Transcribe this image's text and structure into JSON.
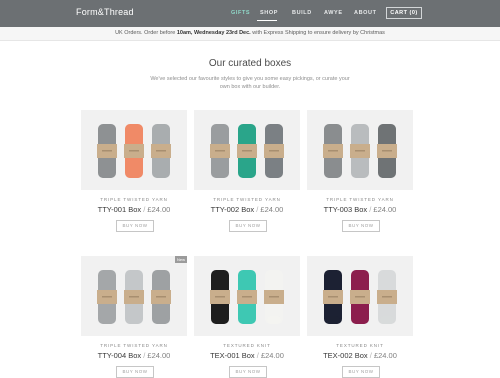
{
  "header": {
    "logo": "Form&Thread",
    "nav": [
      {
        "label": "Gifts",
        "active": true
      },
      {
        "label": "Shop",
        "active": false
      },
      {
        "label": "Build",
        "active": false
      },
      {
        "label": "AWYE",
        "active": false
      },
      {
        "label": "About",
        "active": false
      }
    ],
    "cart_label": "Cart (0)"
  },
  "announcement": {
    "pre": "UK Orders. Order before ",
    "bold": "10am, Wednesday 23rd Dec.",
    "post": " with Express Shipping to ensure delivery by Christmas"
  },
  "section": {
    "title": "Our curated boxes",
    "subtitle": "We've selected our favourite styles to give you some easy pickings, or curate your own box with our builder."
  },
  "products": [
    {
      "category": "Triple Twisted Yarn",
      "code": "TTY-001 Box",
      "price": "£24.00",
      "buy": "Buy Now",
      "badge": "",
      "sock_colors": [
        "#8e9193",
        "#f08a67",
        "#a9adaf"
      ]
    },
    {
      "category": "Triple Twisted Yarn",
      "code": "TTY-002 Box",
      "price": "£24.00",
      "buy": "Buy Now",
      "badge": "",
      "sock_colors": [
        "#9a9d9f",
        "#2aa58a",
        "#7b8084"
      ]
    },
    {
      "category": "Triple Twisted Yarn",
      "code": "TTY-003 Box",
      "price": "£24.00",
      "buy": "Buy Now",
      "badge": "",
      "sock_colors": [
        "#8a8d8f",
        "#b9bcbe",
        "#6f7375"
      ]
    },
    {
      "category": "Triple Twisted Yarn",
      "code": "TTY-004 Box",
      "price": "£24.00",
      "buy": "Buy Now",
      "badge": "New",
      "sock_colors": [
        "#a4a7a9",
        "#c4c7c9",
        "#9ea1a3"
      ]
    },
    {
      "category": "Textured Knit",
      "code": "TEX-001 Box",
      "price": "£24.00",
      "buy": "Buy Now",
      "badge": "",
      "sock_colors": [
        "#1e1e1e",
        "#3ec8b3",
        "#f3f3f1"
      ]
    },
    {
      "category": "Textured Knit",
      "code": "TEX-002 Box",
      "price": "£24.00",
      "buy": "Buy Now",
      "badge": "",
      "sock_colors": [
        "#1c2133",
        "#8c1e4d",
        "#d8dadb"
      ]
    }
  ],
  "colors": {
    "header_bg": "#6c7073",
    "nav_active": "#8fd7c8",
    "card_bg": "#f1f1f1",
    "sock_band": "#c9ae8c"
  }
}
